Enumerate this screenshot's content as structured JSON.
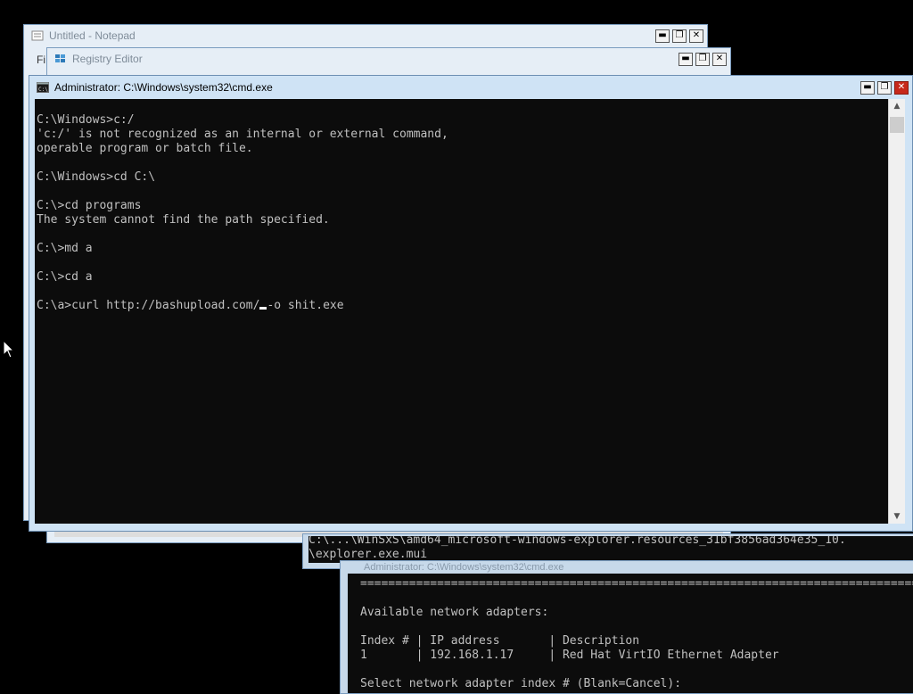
{
  "notepad": {
    "title": "Untitled - Notepad",
    "menu_fragment": "Fi"
  },
  "regedit": {
    "title": "Registry Editor"
  },
  "cmd_main": {
    "title": "Administrator: C:\\Windows\\system32\\cmd.exe",
    "lines": [
      "C:\\Windows>c:/",
      "'c:/' is not recognized as an internal or external command,",
      "operable program or batch file.",
      "",
      "C:\\Windows>cd C:\\",
      "",
      "C:\\>cd programs",
      "The system cannot find the path specified.",
      "",
      "C:\\>md a",
      "",
      "C:\\>cd a",
      ""
    ],
    "input_line_before": "C:\\a>curl http://bashupload.com/",
    "input_line_after": "-o shit.exe"
  },
  "cmd_back": {
    "line1": "C:\\...\\WinSxS\\amd64_microsoft-windows-explorer.resources_31bf3856ad364e35_10.",
    "line2": "\\explorer.exe.mui"
  },
  "cmd_network": {
    "title": "Administrator: C:\\Windows\\system32\\cmd.exe",
    "separator": "==========================================================================================",
    "heading": "Available network adapters:",
    "header": "Index # | IP address       | Description",
    "row": "1       | 192.168.1.17     | Red Hat VirtIO Ethernet Adapter",
    "prompt": "Select network adapter index # (Blank=Cancel):"
  },
  "controls": {
    "minimize": "▬",
    "maximize": "❐",
    "close": "✕"
  },
  "scroll": {
    "up": "▲",
    "down": "▼"
  }
}
